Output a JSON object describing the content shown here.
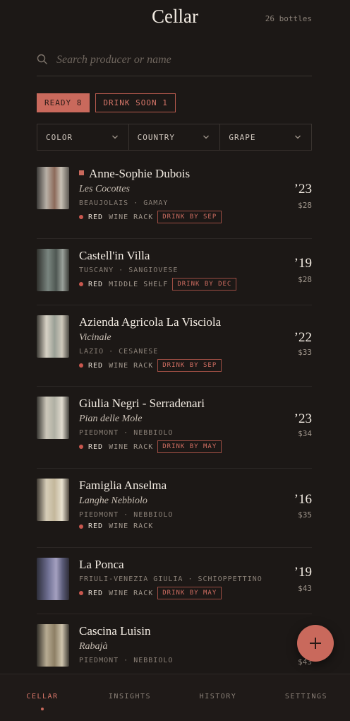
{
  "header": {
    "title": "Cellar",
    "bottle_count": "26 bottles"
  },
  "search": {
    "placeholder": "Search producer or name",
    "value": ""
  },
  "status_chips": [
    {
      "label": "READY 8",
      "active": true
    },
    {
      "label": "DRINK SOON 1",
      "active": false
    }
  ],
  "filters": [
    {
      "label": "COLOR"
    },
    {
      "label": "COUNTRY"
    },
    {
      "label": "GRAPE"
    }
  ],
  "wines": [
    {
      "producer": "Anne-Sophie Dubois",
      "name": "Les Cocottes",
      "region": "BEAUJOLAIS · GAMAY",
      "color": "RED",
      "location": "WINE RACK",
      "badge": "DRINK BY SEP",
      "vintage": "’23",
      "price": "$28",
      "flagged": true
    },
    {
      "producer": "Castell'in Villa",
      "name": "",
      "region": "TUSCANY · SANGIOVESE",
      "color": "RED",
      "location": "MIDDLE SHELF",
      "badge": "DRINK BY DEC",
      "vintage": "’19",
      "price": "$28"
    },
    {
      "producer": "Azienda Agricola La Visciola",
      "name": "Vicinale",
      "region": "LAZIO · CESANESE",
      "color": "RED",
      "location": "WINE RACK",
      "badge": "DRINK BY SEP",
      "vintage": "’22",
      "price": "$33"
    },
    {
      "producer": "Giulia Negri - Serradenari",
      "name": "Pian delle Mole",
      "region": "PIEDMONT · NEBBIOLO",
      "color": "RED",
      "location": "WINE RACK",
      "badge": "DRINK BY MAY",
      "vintage": "’23",
      "price": "$34"
    },
    {
      "producer": "Famiglia Anselma",
      "name": "Langhe Nebbiolo",
      "region": "PIEDMONT · NEBBIOLO",
      "color": "RED",
      "location": "WINE RACK",
      "badge": "",
      "vintage": "’16",
      "price": "$35"
    },
    {
      "producer": "La Ponca",
      "name": "",
      "region": "FRIULI-VENEZIA GIULIA · SCHIOPPETTINO",
      "color": "RED",
      "location": "WINE RACK",
      "badge": "DRINK BY MAY",
      "vintage": "’19",
      "price": "$43"
    },
    {
      "producer": "Cascina Luisin",
      "name": "Rabajà",
      "region": "PIEDMONT · NEBBIOLO",
      "color": "RED",
      "location": "WINE RACK",
      "badge": "",
      "vintage": "’",
      "price": "$43"
    }
  ],
  "tabs": [
    {
      "label": "CELLAR",
      "active": true
    },
    {
      "label": "INSIGHTS",
      "active": false
    },
    {
      "label": "HISTORY",
      "active": false
    },
    {
      "label": "SETTINGS",
      "active": false
    }
  ],
  "icons": {
    "search": "search-icon",
    "chevron": "chevron-down-icon",
    "add": "plus-icon"
  },
  "colors": {
    "accent": "#c9695c",
    "background": "#1c1816",
    "red_dot": "#c9574e"
  }
}
